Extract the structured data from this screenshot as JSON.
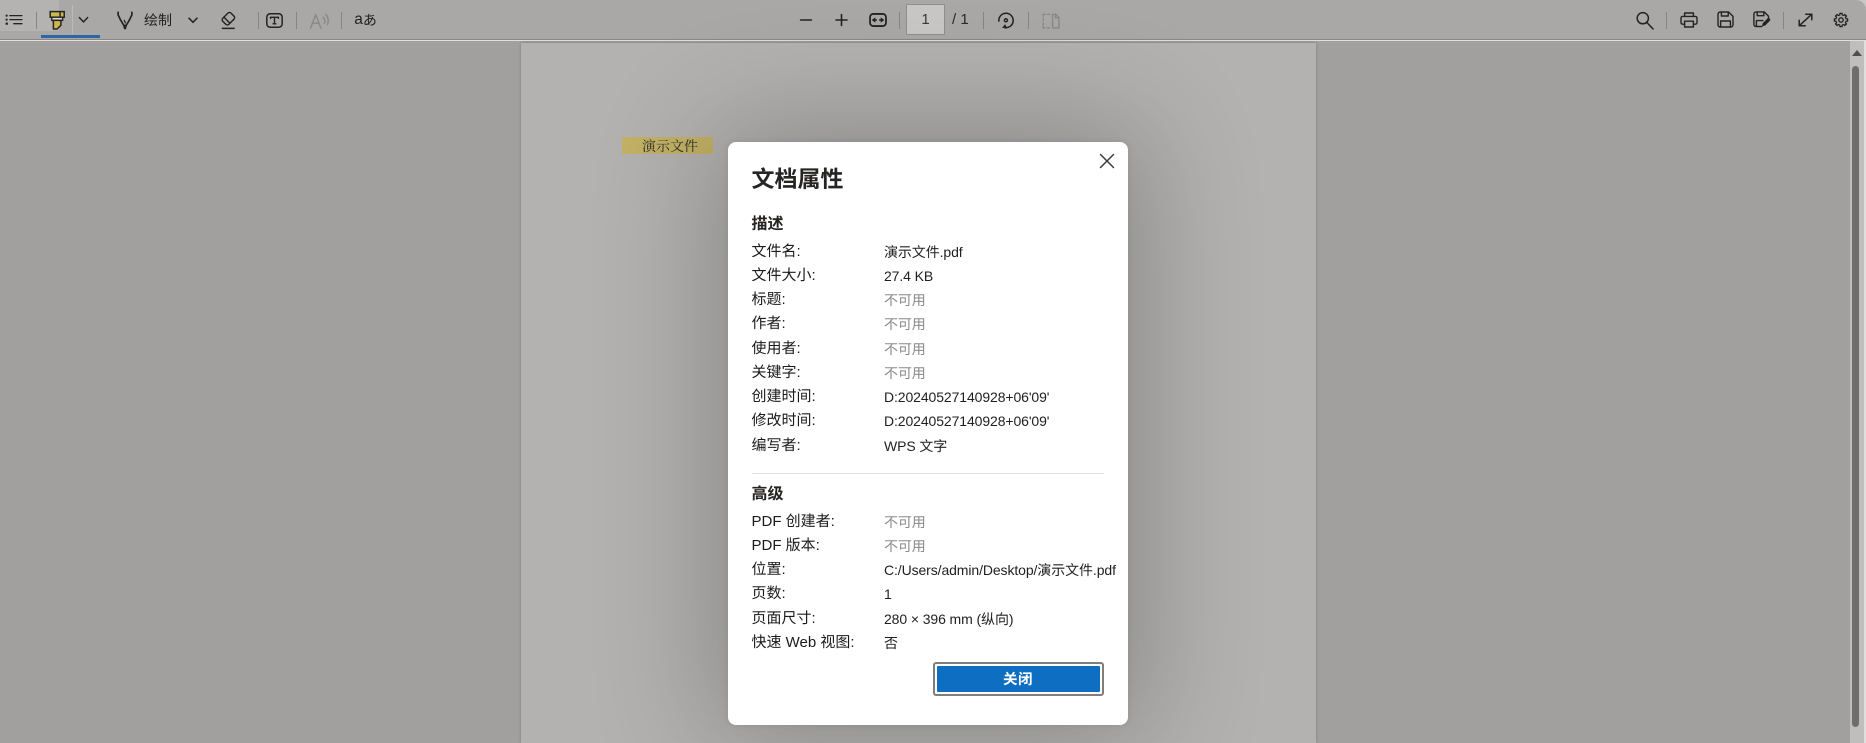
{
  "app": "Microsoft Edge PDF viewer",
  "colors": {
    "accent_blue": "#0e6ec2",
    "tool_underline_blue": "#2b66a7",
    "highlight_yellow": "#c2b166",
    "toolbar_bg": "#a9a8a7",
    "canvas_bg": "#a1a09f",
    "page_bg": "#b3b2b1",
    "dialog_bg": "#ffffff"
  },
  "toolbar": {
    "menu_icon": "table-of-contents-icon",
    "highlight_tool": {
      "icon": "highlighter-icon",
      "active": true,
      "has_dropdown": true
    },
    "draw_tool": {
      "label": "绘制",
      "icon": "pen-nib-icon",
      "has_dropdown": true
    },
    "erase_tool": {
      "icon": "eraser-icon"
    },
    "add_text_tool": {
      "icon": "add-text-icon"
    },
    "read_aloud_tool": {
      "icon": "read-aloud-icon",
      "disabled": true
    },
    "translate_tool": {
      "label_latin": "a",
      "label_hiragana": "あ"
    },
    "zoom_out_icon": "minus-icon",
    "zoom_in_icon": "plus-icon",
    "fit_icon": "fit-to-width-icon",
    "page_field": {
      "value": "1"
    },
    "page_total": "/ 1",
    "rotate_icon": "rotate-icon",
    "page_view_icon": "page-view-icon",
    "search_icon": "search-icon",
    "print_icon": "printer-icon",
    "save_icon": "save-icon",
    "save_as_icon": "save-as-icon",
    "fullscreen_icon": "fullscreen-icon",
    "settings_icon": "gear-icon"
  },
  "pdf_page": {
    "highlighted_text": "演示文件"
  },
  "scrollbar": {
    "up_arrow_icon": "scroll-up-arrow-icon"
  },
  "dialog": {
    "title": "文档属性",
    "close_icon": "close-icon",
    "sections": [
      {
        "heading": "描述",
        "rows": [
          {
            "label": "文件名:",
            "value": "演示文件.pdf",
            "muted": false
          },
          {
            "label": "文件大小:",
            "value": "27.4 KB",
            "muted": false
          },
          {
            "label": "标题:",
            "value": "不可用",
            "muted": true
          },
          {
            "label": "作者:",
            "value": "不可用",
            "muted": true
          },
          {
            "label": "使用者:",
            "value": "不可用",
            "muted": true
          },
          {
            "label": "关键字:",
            "value": "不可用",
            "muted": true
          },
          {
            "label": "创建时间:",
            "value": "D:20240527140928+06'09'",
            "muted": false
          },
          {
            "label": "修改时间:",
            "value": "D:20240527140928+06'09'",
            "muted": false
          },
          {
            "label": "编写者:",
            "value": "WPS 文字",
            "muted": false
          }
        ]
      },
      {
        "heading": "高级",
        "rows": [
          {
            "label": "PDF 创建者:",
            "value": "不可用",
            "muted": true
          },
          {
            "label": "PDF 版本:",
            "value": "不可用",
            "muted": true
          },
          {
            "label": "位置:",
            "value": "C:/Users/admin/Desktop/演示文件.pdf",
            "muted": false
          },
          {
            "label": "页数:",
            "value": "1",
            "muted": false
          },
          {
            "label": "页面尺寸:",
            "value": "280 × 396 mm (纵向)",
            "muted": false
          },
          {
            "label": "快速 Web 视图:",
            "value": "否",
            "muted": false
          }
        ]
      }
    ],
    "close_button": "关闭"
  }
}
